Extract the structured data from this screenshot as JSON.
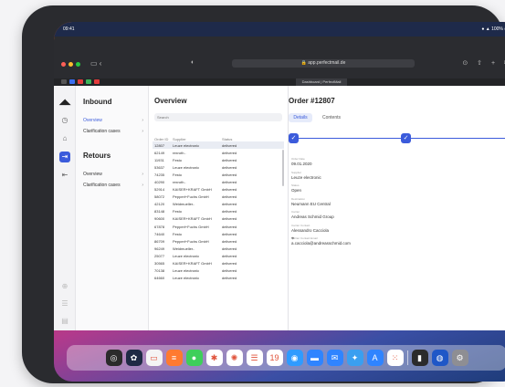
{
  "status_bar": {
    "time": "09:41",
    "battery": "100%"
  },
  "browser": {
    "url": "app.perfectmail.de",
    "active_tab": "Dashboard | PerfectMail"
  },
  "sidebar": {
    "inbound_title": "Inbound",
    "inbound_items": [
      {
        "label": "Overview",
        "active": true
      },
      {
        "label": "Clarification cases",
        "active": false
      }
    ],
    "retours_title": "Retours",
    "retours_items": [
      {
        "label": "Overview",
        "active": false
      },
      {
        "label": "Clarification cases",
        "active": false
      }
    ]
  },
  "overview": {
    "title": "Overview",
    "search_placeholder": "Search",
    "columns": [
      "Order ID",
      "Supplier",
      "Status"
    ],
    "rows": [
      {
        "id": "12807",
        "supplier": "Leuze electronic",
        "status": "delivered"
      },
      {
        "id": "62149",
        "supplier": "rexroth..",
        "status": "delivered"
      },
      {
        "id": "11931",
        "supplier": "Festo",
        "status": "delivered"
      },
      {
        "id": "53637",
        "supplier": "Leuze electronic",
        "status": "delivered"
      },
      {
        "id": "74235",
        "supplier": "Festo",
        "status": "delivered"
      },
      {
        "id": "40290",
        "supplier": "rexroth..",
        "status": "delivered"
      },
      {
        "id": "52914",
        "supplier": "KAISER+KRAFT GmbH",
        "status": "delivered"
      },
      {
        "id": "58072",
        "supplier": "Pepperl+Fuchs GmbH",
        "status": "delivered"
      },
      {
        "id": "42120",
        "supplier": "Weidmueller..",
        "status": "delivered"
      },
      {
        "id": "83148",
        "supplier": "Festo",
        "status": "delivered"
      },
      {
        "id": "90600",
        "supplier": "KAISER+KRAFT GmbH",
        "status": "delivered"
      },
      {
        "id": "67878",
        "supplier": "Pepperl+Fuchs GmbH",
        "status": "delivered"
      },
      {
        "id": "74640",
        "supplier": "Festo",
        "status": "delivered"
      },
      {
        "id": "86709",
        "supplier": "Pepperl+Fuchs GmbH",
        "status": "delivered"
      },
      {
        "id": "96249",
        "supplier": "Weidmueller..",
        "status": "delivered"
      },
      {
        "id": "25077",
        "supplier": "Leuze electronic",
        "status": "delivered"
      },
      {
        "id": "30565",
        "supplier": "KAISER+KRAFT GmbH",
        "status": "delivered"
      },
      {
        "id": "70138",
        "supplier": "Leuze electronic",
        "status": "delivered"
      },
      {
        "id": "64660",
        "supplier": "Leuze electronic",
        "status": "delivered"
      }
    ]
  },
  "detail": {
    "title": "Order #12807",
    "tabs": [
      "Details",
      "Contents"
    ],
    "fields": [
      {
        "label": "Order Date",
        "value": "09.01.2020"
      },
      {
        "label": "Supplier",
        "value": "Leuze electronic"
      },
      {
        "label": "Status",
        "value": "Open"
      },
      {
        "label": "Destination",
        "value": "Neumann EU Central"
      },
      {
        "label": "Carrier",
        "value": "Andreas Schmid Group"
      },
      {
        "label": "Carrier Contact",
        "value": "Alessandro Cacciola"
      },
      {
        "label": "Carrier Contact Email",
        "value": "a.cacciola@andreasschmid.com"
      }
    ]
  },
  "dock": {
    "apps": [
      {
        "name": "fingerprint-icon",
        "glyph": "◎",
        "color": "#2b2b2b"
      },
      {
        "name": "butterfly-icon",
        "glyph": "✿",
        "color": "#1f2a44"
      },
      {
        "name": "notes-icon",
        "glyph": "▭",
        "color": "#f4f4f4"
      },
      {
        "name": "lists-icon",
        "glyph": "≡",
        "color": "#ff7a30"
      },
      {
        "name": "messages-icon",
        "glyph": "●",
        "color": "#3ecf5a"
      },
      {
        "name": "slack-icon",
        "glyph": "✱",
        "color": "#ffffff"
      },
      {
        "name": "photos-icon",
        "glyph": "✺",
        "color": "#ffffff"
      },
      {
        "name": "reminders-icon",
        "glyph": "☰",
        "color": "#ffffff"
      },
      {
        "name": "calendar-icon",
        "glyph": "19",
        "color": "#ffffff"
      },
      {
        "name": "safari-icon",
        "glyph": "◉",
        "color": "#2f9bff"
      },
      {
        "name": "files-icon",
        "glyph": "▬",
        "color": "#2f84ff"
      },
      {
        "name": "mail-icon",
        "glyph": "✉",
        "color": "#2f84ff"
      },
      {
        "name": "twitter-icon",
        "glyph": "✦",
        "color": "#3a9ff0"
      },
      {
        "name": "appstore-icon",
        "glyph": "A",
        "color": "#2f84ff"
      },
      {
        "name": "grid-app-icon",
        "glyph": "⁙",
        "color": "#ffffff"
      },
      {
        "name": "voice-memos-icon",
        "glyph": "▮",
        "color": "#2b2b2b"
      },
      {
        "name": "globe-icon",
        "glyph": "◍",
        "color": "#1f57c7"
      },
      {
        "name": "settings-icon",
        "glyph": "⚙",
        "color": "#8e8e93"
      }
    ]
  }
}
